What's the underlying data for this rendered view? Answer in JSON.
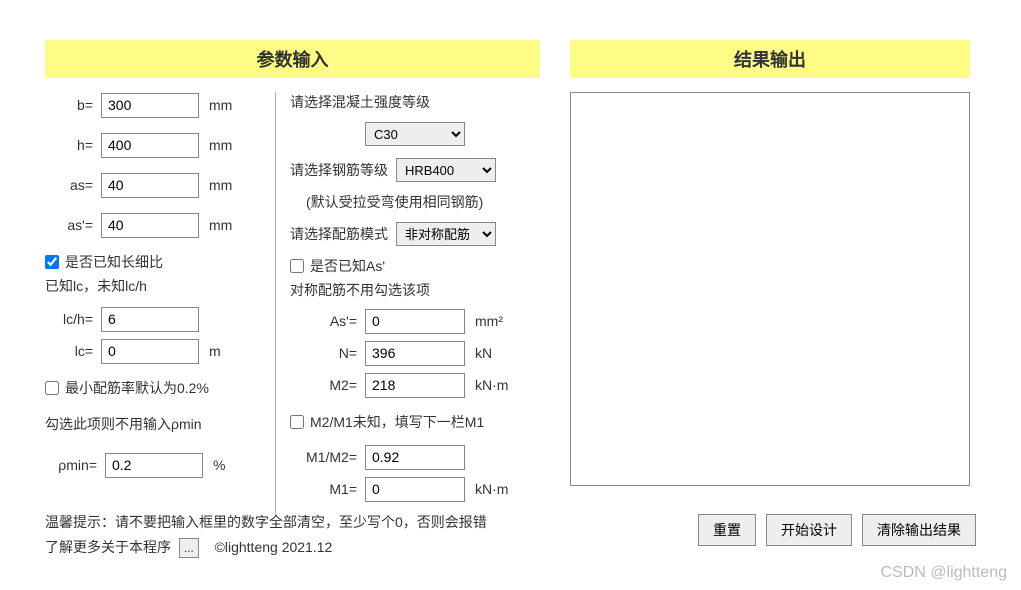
{
  "headers": {
    "input": "参数输入",
    "output": "结果输出"
  },
  "left": {
    "b_label": "b=",
    "b_value": "300",
    "b_unit": "mm",
    "h_label": "h=",
    "h_value": "400",
    "h_unit": "mm",
    "as_label": "as=",
    "as_value": "40",
    "as_unit": "mm",
    "asp_label": "as'=",
    "asp_value": "40",
    "asp_unit": "mm",
    "slender_check": "是否已知长细比",
    "slender_checked": true,
    "slender_note": "已知lc，未知lc/h",
    "lch_label": "lc/h=",
    "lch_value": "6",
    "lc_label": "lc=",
    "lc_value": "0",
    "lc_unit": "m",
    "min_ratio_check": "最小配筋率默认为0.2%",
    "min_ratio_checked": false,
    "min_ratio_note": "勾选此项则不用输入ρmin",
    "pmin_label": "ρmin=",
    "pmin_value": "0.2",
    "pmin_unit": "%"
  },
  "right": {
    "concrete_label": "请选择混凝土强度等级",
    "concrete_value": "C30",
    "rebar_label": "请选择钢筋等级",
    "rebar_value": "HRB400",
    "rebar_note": "(默认受拉受弯使用相同钢筋)",
    "mode_label": "请选择配筋模式",
    "mode_value": "非对称配筋",
    "asp_known_check": "是否已知As'",
    "asp_known_checked": false,
    "sym_note": "对称配筋不用勾选该项",
    "Asp_label": "As'=",
    "Asp_value": "0",
    "Asp_unit": "mm²",
    "N_label": "N=",
    "N_value": "396",
    "N_unit": "kN",
    "M2_label": "M2=",
    "M2_value": "218",
    "M2_unit": "kN·m",
    "m2m1_check": "M2/M1未知，填写下一栏M1",
    "m2m1_checked": false,
    "M1M2_label": "M1/M2=",
    "M1M2_value": "0.92",
    "M1_label": "M1=",
    "M1_value": "0",
    "M1_unit": "kN·m"
  },
  "hint": {
    "line1": "温馨提示：请不要把输入框里的数字全部清空，至少写个0，否则会报错",
    "line2a": "了解更多关于本程序",
    "about_icon": "...",
    "copyright": "©lightteng 2021.12"
  },
  "buttons": {
    "reset": "重置",
    "start": "开始设计",
    "clear": "清除输出结果"
  },
  "watermark": "CSDN @lightteng"
}
